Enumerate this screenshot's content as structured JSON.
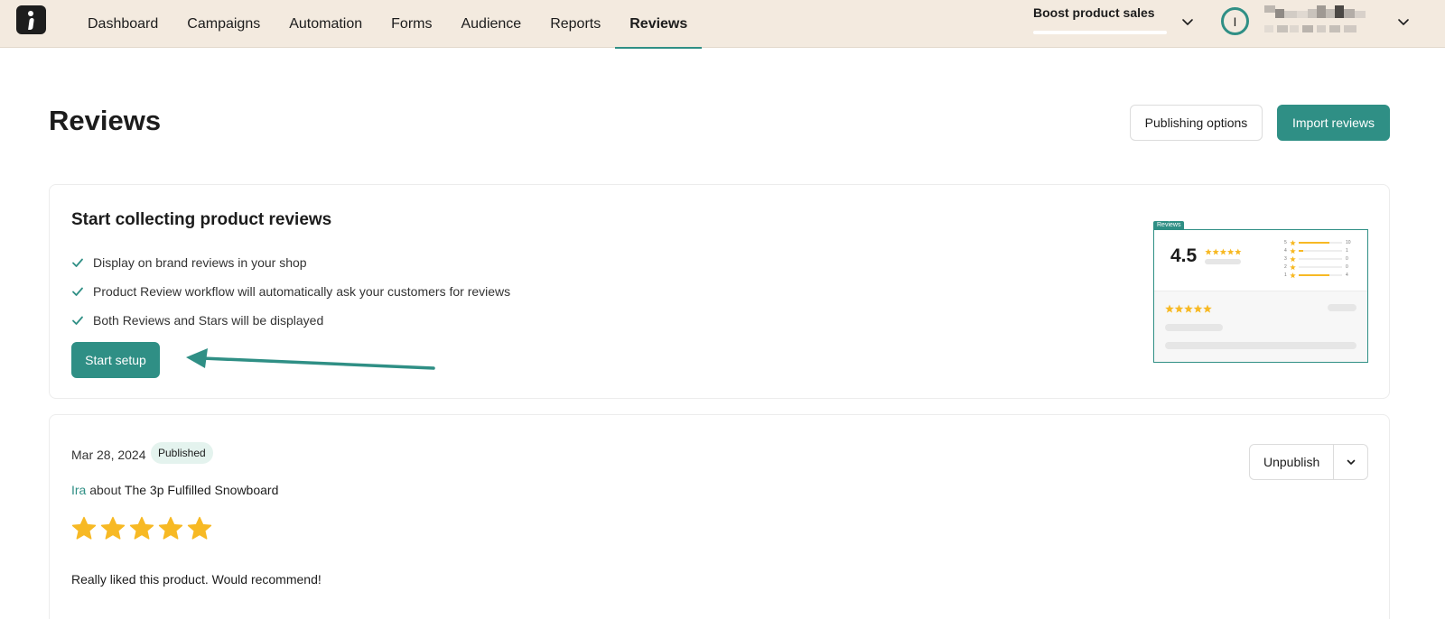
{
  "nav": {
    "items": [
      "Dashboard",
      "Campaigns",
      "Automation",
      "Forms",
      "Audience",
      "Reports",
      "Reviews"
    ],
    "active": "Reviews"
  },
  "goal": {
    "label": "Boost product sales"
  },
  "account": {
    "avatar_letter": "I"
  },
  "header": {
    "title": "Reviews",
    "publishing_options": "Publishing options",
    "import_reviews": "Import reviews"
  },
  "setup": {
    "title": "Start collecting product reviews",
    "bullets": [
      "Display on brand reviews in your shop",
      "Product Review workflow will automatically ask your customers for reviews",
      "Both Reviews and Stars will be displayed"
    ],
    "button": "Start setup",
    "preview": {
      "tag": "Reviews",
      "rating": "4.5",
      "distribution": [
        {
          "stars": "5",
          "count": "10"
        },
        {
          "stars": "4",
          "count": "1"
        },
        {
          "stars": "3",
          "count": "0"
        },
        {
          "stars": "2",
          "count": "0"
        },
        {
          "stars": "1",
          "count": "4"
        }
      ]
    }
  },
  "review": {
    "date": "Mar 28, 2024",
    "status": "Published",
    "author": "Ira",
    "about": "about",
    "product": "The 3p Fulfilled Snowboard",
    "rating": 5,
    "text": "Really liked this product. Would recommend!",
    "unpublish": "Unpublish"
  },
  "colors": {
    "accent": "#2f8f85",
    "topbar": "#f3eadf",
    "star": "#f7b924",
    "badge": "#e4f3ee"
  },
  "icons": {
    "logo": "brand-logo-icon",
    "check": "check-icon",
    "chevron": "chevron-down-icon",
    "star": "star-icon"
  }
}
